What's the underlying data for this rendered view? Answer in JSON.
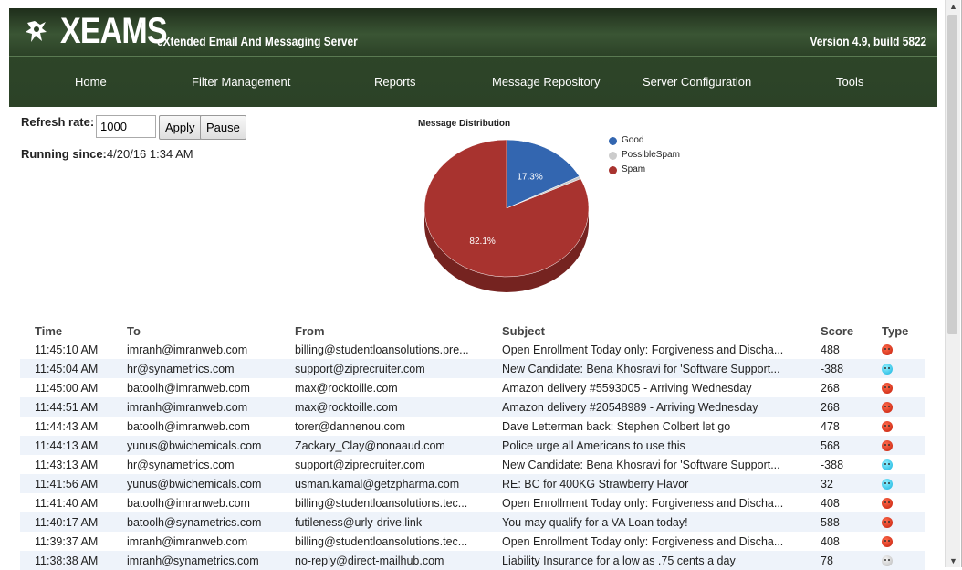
{
  "header": {
    "title": "XEAMS",
    "tagline": "eXtended Email And Messaging Server",
    "version": "Version 4.9, build 5822"
  },
  "nav": [
    "Home",
    "Filter Management",
    "Reports",
    "Message Repository",
    "Server Configuration",
    "Tools"
  ],
  "controls": {
    "refresh_label": "Refresh rate:",
    "refresh_value": "1000",
    "apply_label": "Apply",
    "pause_label": "Pause",
    "running_label": "Running since:",
    "running_value": "4/20/16 1:34 AM"
  },
  "chart_data": {
    "type": "pie",
    "title": "Message Distribution",
    "categories": [
      "Good",
      "PossibleSpam",
      "Spam"
    ],
    "values": [
      17.3,
      0.6,
      82.1
    ],
    "colors": [
      "#3366b0",
      "#cccccc",
      "#a8332f"
    ],
    "data_labels": [
      "17.3%",
      "",
      "82.1%"
    ]
  },
  "table": {
    "headers": [
      "Time",
      "To",
      "From",
      "Subject",
      "Score",
      "Type"
    ],
    "rows": [
      {
        "time": "11:45:10 AM",
        "to": "imranh@imranweb.com",
        "from": "billing@studentloansolutions.pre...",
        "subject": "Open Enrollment Today only: Forgiveness and Discha...",
        "score": "488",
        "type": "bad"
      },
      {
        "time": "11:45:04 AM",
        "to": "hr@synametrics.com",
        "from": "support@ziprecruiter.com",
        "subject": "New Candidate: Bena Khosravi for 'Software Support...",
        "score": "-388",
        "type": "good"
      },
      {
        "time": "11:45:00 AM",
        "to": "batoolh@imranweb.com",
        "from": "max@rocktoille.com",
        "subject": "Amazon delivery #5593005 - Arriving Wednesday",
        "score": "268",
        "type": "bad"
      },
      {
        "time": "11:44:51 AM",
        "to": "imranh@imranweb.com",
        "from": "max@rocktoille.com",
        "subject": "Amazon delivery #20548989 - Arriving Wednesday",
        "score": "268",
        "type": "bad"
      },
      {
        "time": "11:44:43 AM",
        "to": "batoolh@imranweb.com",
        "from": "torer@dannenou.com",
        "subject": "Dave Letterman back: Stephen Colbert let go",
        "score": "478",
        "type": "bad"
      },
      {
        "time": "11:44:13 AM",
        "to": "yunus@bwichemicals.com",
        "from": "Zackary_Clay@nonaaud.com",
        "subject": "Police urge all Americans to use this",
        "score": "568",
        "type": "bad"
      },
      {
        "time": "11:43:13 AM",
        "to": "hr@synametrics.com",
        "from": "support@ziprecruiter.com",
        "subject": "New Candidate: Bena Khosravi for 'Software Support...",
        "score": "-388",
        "type": "good"
      },
      {
        "time": "11:41:56 AM",
        "to": "yunus@bwichemicals.com",
        "from": "usman.kamal@getzpharma.com",
        "subject": "RE: BC for 400KG Strawberry Flavor",
        "score": "32",
        "type": "good"
      },
      {
        "time": "11:41:40 AM",
        "to": "batoolh@imranweb.com",
        "from": "billing@studentloansolutions.tec...",
        "subject": "Open Enrollment Today only: Forgiveness and Discha...",
        "score": "408",
        "type": "bad"
      },
      {
        "time": "11:40:17 AM",
        "to": "batoolh@synametrics.com",
        "from": "futileness@urly-drive.link",
        "subject": "You may qualify for a VA Loan today!",
        "score": "588",
        "type": "bad"
      },
      {
        "time": "11:39:37 AM",
        "to": "imranh@imranweb.com",
        "from": "billing@studentloansolutions.tec...",
        "subject": "Open Enrollment Today only: Forgiveness and Discha...",
        "score": "408",
        "type": "bad"
      },
      {
        "time": "11:38:38 AM",
        "to": "imranh@synametrics.com",
        "from": "no-reply@direct-mailhub.com",
        "subject": "Liability Insurance for a low as .75 cents a day",
        "score": "78",
        "type": "neutral"
      }
    ]
  }
}
